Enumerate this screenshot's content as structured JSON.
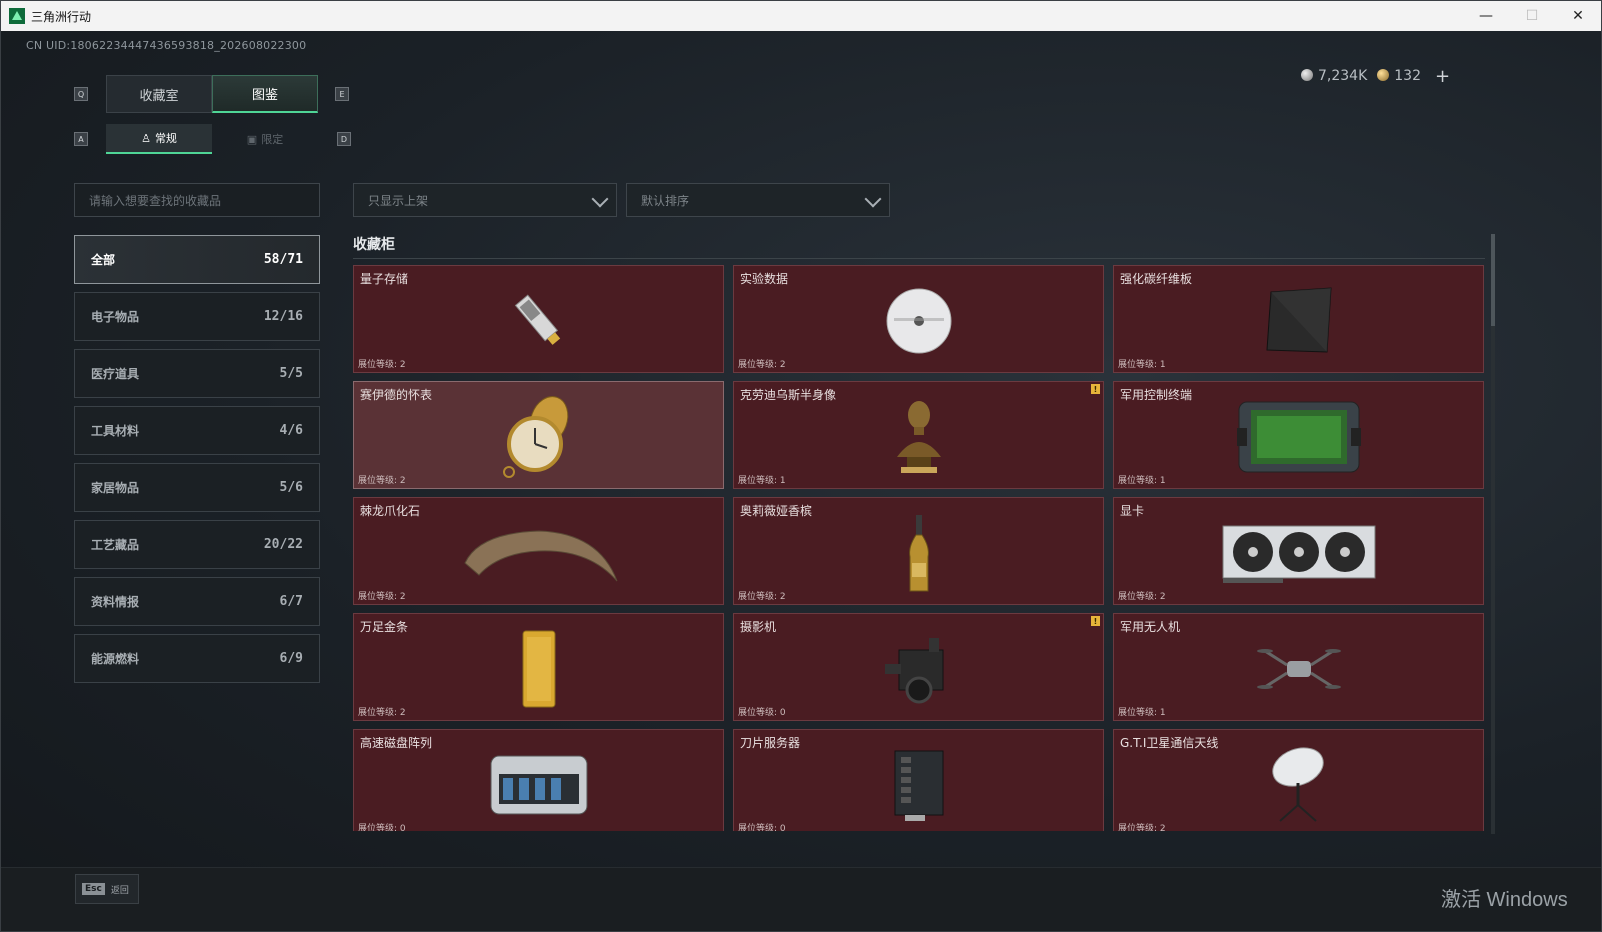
{
  "window": {
    "title": "三角洲行动",
    "minimize": "—",
    "maximize": "☐",
    "close": "✕"
  },
  "uid": "CN UID:18062234447436593818_202608022300",
  "currency": {
    "silver": "7,234K",
    "gold": "132",
    "add": "+"
  },
  "keys": {
    "left_main": "Q",
    "right_main": "E",
    "left_sub": "A",
    "right_sub": "D"
  },
  "tabs": {
    "main": [
      {
        "label": "收藏室"
      },
      {
        "label": "图鉴"
      }
    ],
    "sub": [
      {
        "label": "常规"
      },
      {
        "label": "限定"
      }
    ]
  },
  "search": {
    "placeholder": "请输入想要查找的收藏品"
  },
  "filters": {
    "display": "只显示上架",
    "sort": "默认排序"
  },
  "categories": [
    {
      "label": "全部",
      "count": "58/71"
    },
    {
      "label": "电子物品",
      "count": "12/16"
    },
    {
      "label": "医疗道具",
      "count": "5/5"
    },
    {
      "label": "工具材料",
      "count": "4/6"
    },
    {
      "label": "家居物品",
      "count": "5/6"
    },
    {
      "label": "工艺藏品",
      "count": "20/22"
    },
    {
      "label": "资料情报",
      "count": "6/7"
    },
    {
      "label": "能源燃料",
      "count": "6/9"
    }
  ],
  "section_title": "收藏柜",
  "items": [
    {
      "name": "量子存储",
      "level": "展位等级: 2",
      "icon": "usb-drive-icon"
    },
    {
      "name": "实验数据",
      "level": "展位等级: 2",
      "icon": "disc-icon"
    },
    {
      "name": "强化碳纤维板",
      "level": "展位等级: 1",
      "icon": "carbon-plate-icon"
    },
    {
      "name": "赛伊德的怀表",
      "level": "展位等级: 2",
      "icon": "pocket-watch-icon"
    },
    {
      "name": "克劳迪乌斯半身像",
      "level": "展位等级: 1",
      "icon": "bust-icon",
      "badge": "!"
    },
    {
      "name": "军用控制终端",
      "level": "展位等级: 1",
      "icon": "terminal-icon"
    },
    {
      "name": "棘龙爪化石",
      "level": "展位等级: 2",
      "icon": "claw-fossil-icon"
    },
    {
      "name": "奥莉薇娅香槟",
      "level": "展位等级: 2",
      "icon": "champagne-icon"
    },
    {
      "name": "显卡",
      "level": "展位等级: 2",
      "icon": "gpu-icon"
    },
    {
      "name": "万足金条",
      "level": "展位等级: 2",
      "icon": "gold-bar-icon"
    },
    {
      "name": "摄影机",
      "level": "展位等级: 0",
      "icon": "camera-icon",
      "badge": "!"
    },
    {
      "name": "军用无人机",
      "level": "展位等级: 1",
      "icon": "drone-icon"
    },
    {
      "name": "高速磁盘阵列",
      "level": "展位等级: 0",
      "icon": "disk-array-icon"
    },
    {
      "name": "刀片服务器",
      "level": "展位等级: 0",
      "icon": "server-icon"
    },
    {
      "name": "G.T.I卫星通信天线",
      "level": "展位等级: 2",
      "icon": "satellite-dish-icon"
    }
  ],
  "esc": {
    "key": "Esc",
    "label": "返回"
  },
  "watermark": "激活 Windows",
  "colors": {
    "accent": "#4fd596",
    "card_bg": "#4a1c22",
    "card_highlight": "#5a3236",
    "badge": "#e7b43a"
  }
}
